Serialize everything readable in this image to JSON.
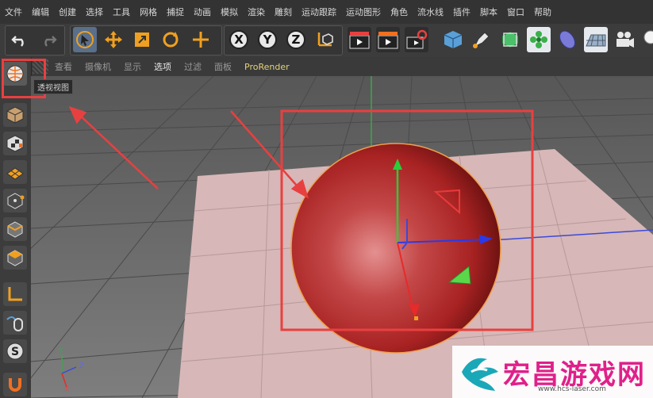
{
  "menu": {
    "items": [
      "文件",
      "编辑",
      "创建",
      "选择",
      "工具",
      "网格",
      "捕捉",
      "动画",
      "模拟",
      "渲染",
      "雕刻",
      "运动跟踪",
      "运动图形",
      "角色",
      "流水线",
      "插件",
      "脚本",
      "窗口",
      "帮助"
    ]
  },
  "toolbar": {
    "axis_x": "X",
    "axis_y": "Y",
    "axis_z": "Z"
  },
  "view_menu": {
    "items": [
      "查看",
      "摄像机",
      "显示",
      "选项",
      "过滤",
      "面板",
      "ProRender"
    ],
    "active": "选项"
  },
  "viewport": {
    "tooltip": "透视视图",
    "axis_labels": {
      "y": "Y",
      "z": "Z",
      "x": "X"
    }
  },
  "watermark": {
    "title": "宏昌游戏网",
    "url": "www.hcs-laser.com"
  },
  "colors": {
    "sphere": "#b02a2a",
    "highlight_box": "#e84040",
    "accent_orange": "#f0a020"
  }
}
